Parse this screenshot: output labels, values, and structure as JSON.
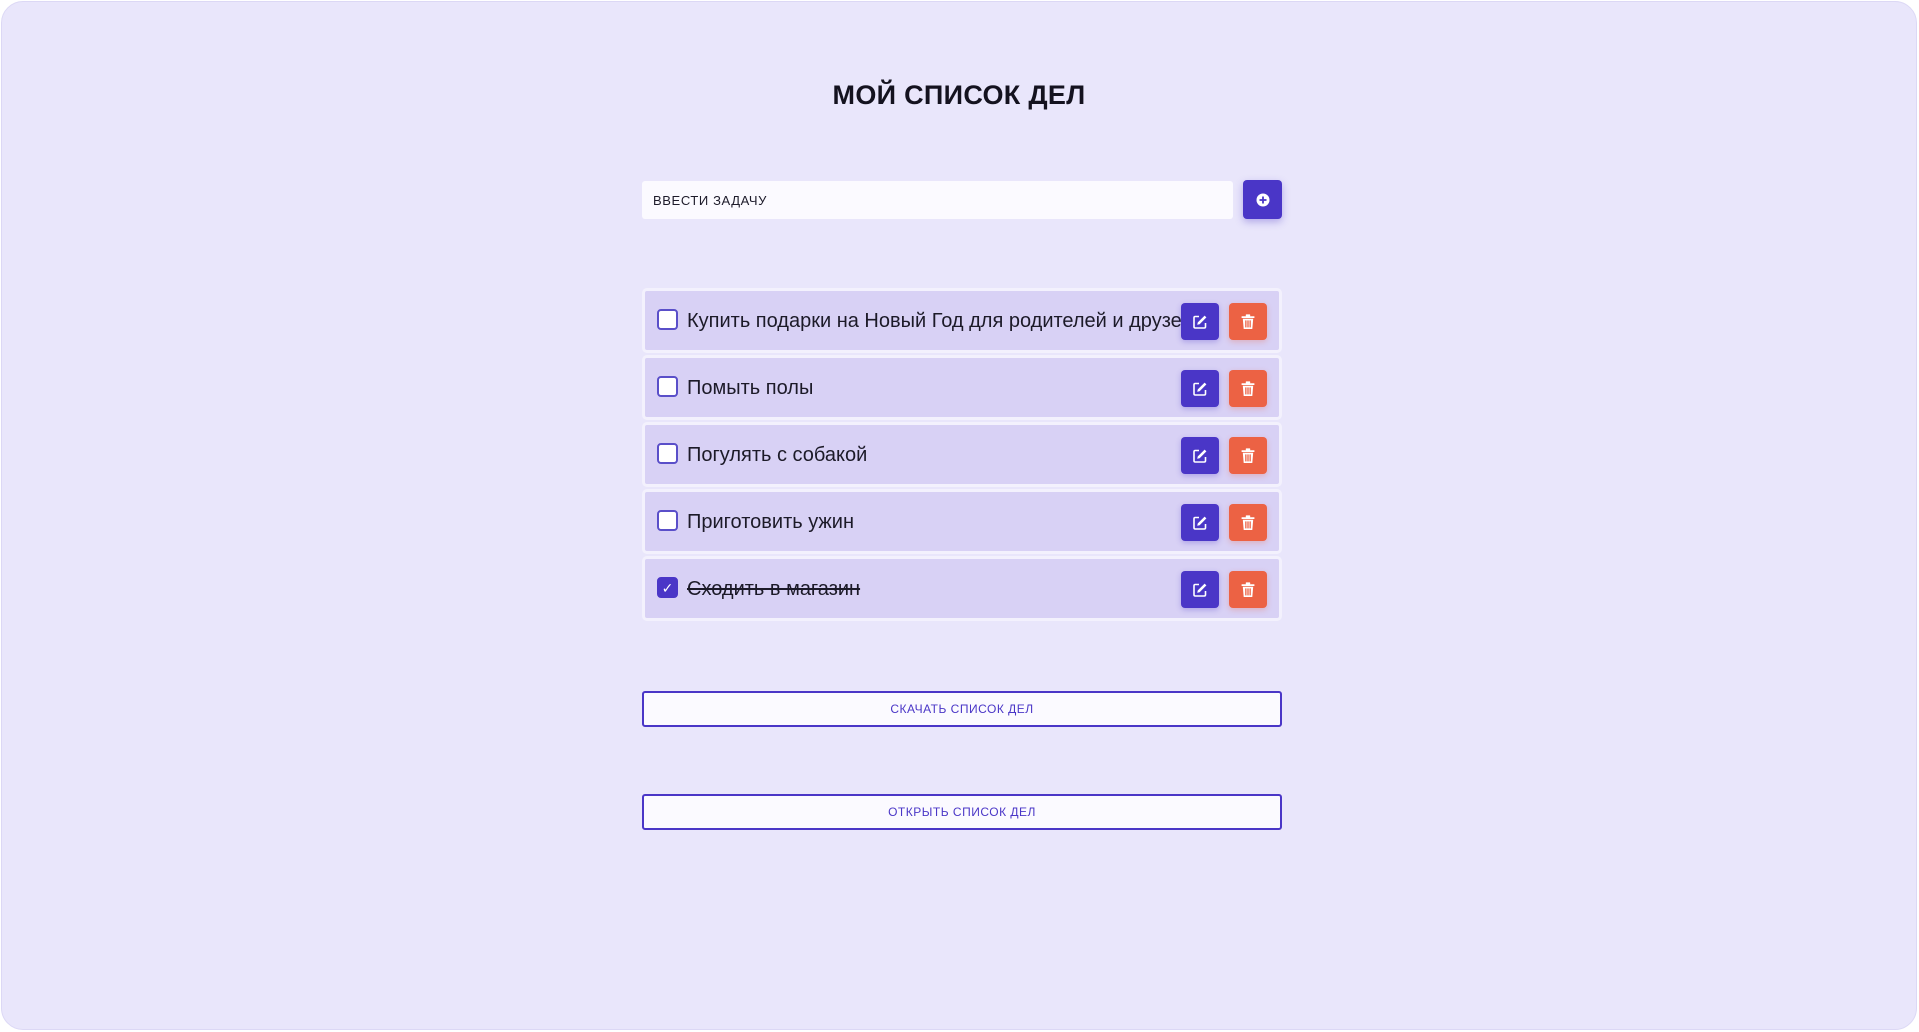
{
  "header": {
    "title": "МОЙ СПИСОК ДЕЛ"
  },
  "new_task": {
    "placeholder": "ВВЕСТИ ЗАДАЧУ",
    "value": "",
    "add_icon": "plus-circle-icon"
  },
  "tasks": [
    {
      "text": "Купить подарки на Новый Год для родителей и друзей",
      "done": false
    },
    {
      "text": "Помыть полы",
      "done": false
    },
    {
      "text": "Погулять с собакой",
      "done": false
    },
    {
      "text": "Приготовить ужин",
      "done": false
    },
    {
      "text": "Сходить в магазин",
      "done": true
    }
  ],
  "task_actions": {
    "edit_icon": "pencil-square-icon",
    "delete_icon": "trash-icon",
    "check_mark": "✓"
  },
  "actions": {
    "download_label": "СКАЧАТЬ СПИСОК ДЕЛ",
    "open_label": "ОТКРЫТЬ СПИСОК ДЕЛ"
  },
  "colors": {
    "background": "#e9e6fb",
    "accent": "#4a36c7",
    "danger": "#ec6244",
    "item_background": "#d8d1f5"
  }
}
